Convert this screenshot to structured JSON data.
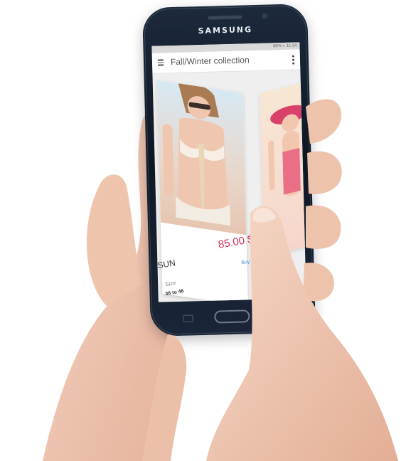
{
  "phone": {
    "brand": "SAMSUNG",
    "status_bar": "68% ◐ 11:34",
    "app_title": "Fall/Winter collection"
  },
  "product": {
    "price": "85.00 $",
    "name": "SUN",
    "buy_label": "Buy",
    "size_label": "Size",
    "size_value": "36 to 46"
  },
  "colors": {
    "price": "#d2305a",
    "buy": "#3c8fd6",
    "phone_body": "#0e1724",
    "skin": "#f0c9b4"
  }
}
